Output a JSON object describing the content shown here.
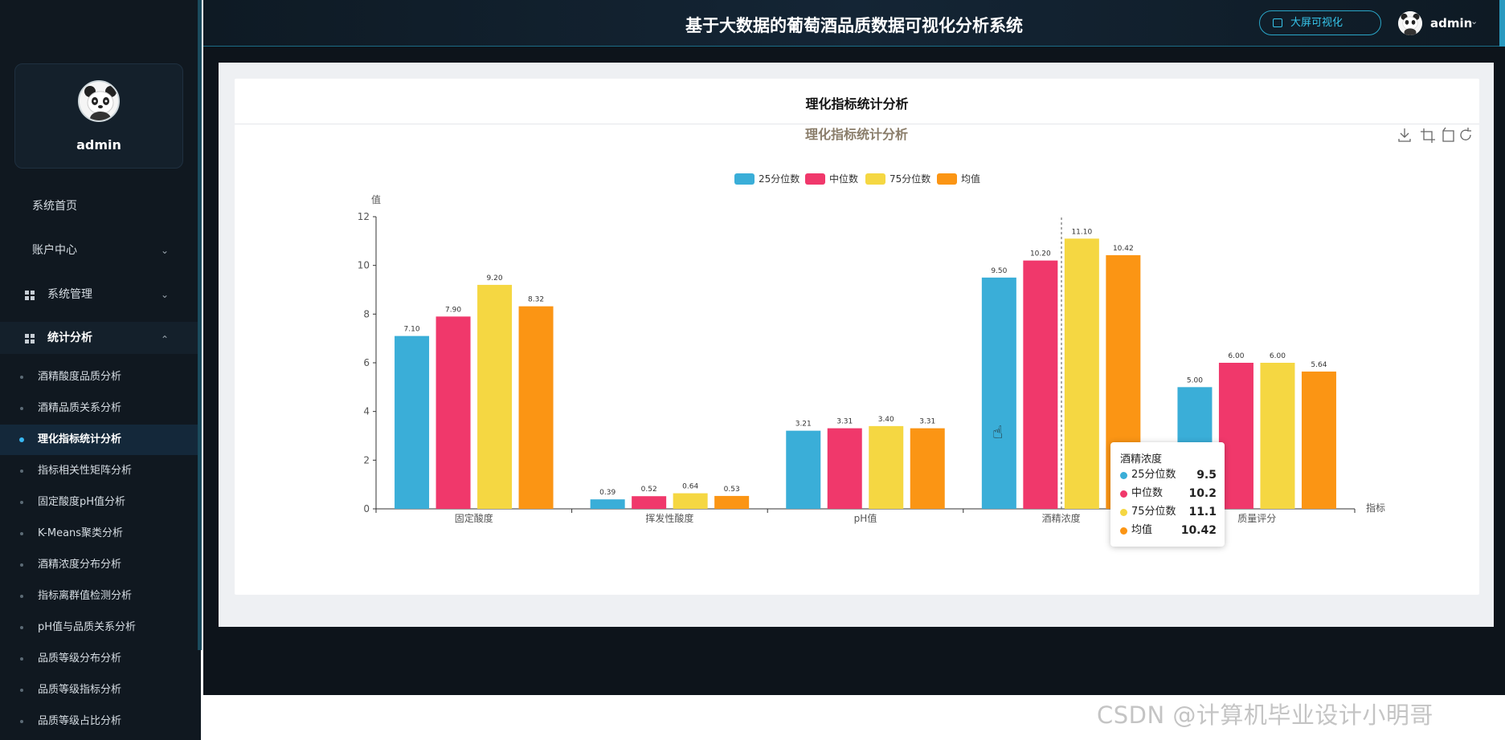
{
  "app": {
    "title": "基于大数据的葡萄酒品质数据可视化分析系统",
    "bigscreen_label": "大屏可视化",
    "user": "admin"
  },
  "sidebar": {
    "profile_name": "admin",
    "items": [
      {
        "label": "系统首页"
      },
      {
        "label": "账户中心"
      },
      {
        "label": "系统管理"
      },
      {
        "label": "统计分析"
      }
    ],
    "sub_items": [
      {
        "label": "酒精酸度品质分析"
      },
      {
        "label": "酒精品质关系分析"
      },
      {
        "label": "理化指标统计分析"
      },
      {
        "label": "指标相关性矩阵分析"
      },
      {
        "label": "固定酸度pH值分析"
      },
      {
        "label": "K-Means聚类分析"
      },
      {
        "label": "酒精浓度分布分析"
      },
      {
        "label": "指标离群值检测分析"
      },
      {
        "label": "pH值与品质关系分析"
      },
      {
        "label": "品质等级分布分析"
      },
      {
        "label": "品质等级指标分析"
      },
      {
        "label": "品质等级占比分析"
      }
    ]
  },
  "panel": {
    "title": "理化指标统计分析"
  },
  "colors": {
    "q25": "#3aaed8",
    "median": "#f0386b",
    "q75": "#f5d742",
    "mean": "#fb9514",
    "accent": "#38b8f2"
  },
  "chart_data": {
    "type": "bar",
    "title": "理化指标统计分析",
    "ylabel": "值",
    "xlabel": "指标",
    "ylim": [
      0,
      12
    ],
    "y_ticks": [
      0,
      2,
      4,
      6,
      8,
      10,
      12
    ],
    "legend_position": "top-center",
    "categories": [
      "固定酸度",
      "挥发性酸度",
      "pH值",
      "酒精浓度",
      "质量评分"
    ],
    "series": [
      {
        "name": "25分位数",
        "values": [
          7.1,
          0.39,
          3.21,
          9.5,
          5.0
        ]
      },
      {
        "name": "中位数",
        "values": [
          7.9,
          0.52,
          3.31,
          10.2,
          6.0
        ]
      },
      {
        "name": "75分位数",
        "values": [
          9.2,
          0.64,
          3.4,
          11.1,
          6.0
        ]
      },
      {
        "name": "均值",
        "values": [
          8.32,
          0.53,
          3.31,
          10.42,
          5.64
        ]
      }
    ],
    "data_labels": [
      [
        "7.10",
        "0.39",
        "3.21",
        "9.50",
        "5.00"
      ],
      [
        "7.90",
        "0.52",
        "3.31",
        "10.20",
        "6.00"
      ],
      [
        "9.20",
        "0.64",
        "3.40",
        "11.10",
        "6.00"
      ],
      [
        "8.32",
        "0.53",
        "3.31",
        "10.42",
        "5.64"
      ]
    ],
    "tooltip": {
      "title": "酒精浓度",
      "rows": [
        {
          "name": "25分位数",
          "value": "9.5"
        },
        {
          "name": "中位数",
          "value": "10.2"
        },
        {
          "name": "75分位数",
          "value": "11.1"
        },
        {
          "name": "均值",
          "value": "10.42"
        }
      ]
    }
  },
  "watermark": "CSDN @计算机毕业设计小明哥"
}
